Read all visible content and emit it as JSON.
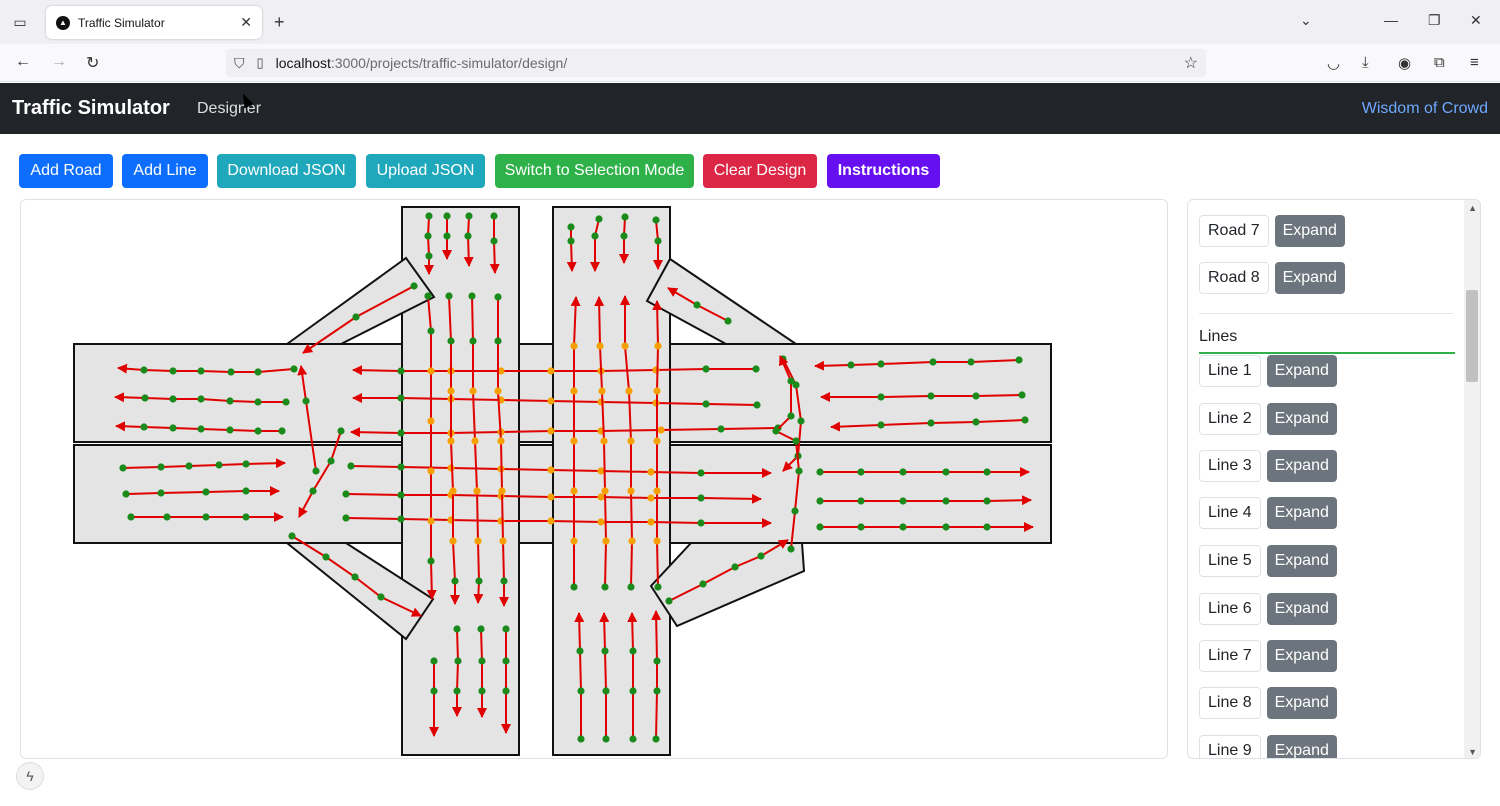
{
  "browser": {
    "tab_title": "Traffic Simulator",
    "url_host": "localhost",
    "url_path": ":3000/projects/traffic-simulator/design/",
    "icons": [
      "tab-list-icon",
      "close-tab-icon",
      "new-tab-icon",
      "minimize-icon",
      "maximize-icon",
      "close-window-icon",
      "back-icon",
      "forward-icon",
      "reload-icon",
      "shield-icon",
      "page-icon",
      "bookmark-star-icon",
      "pocket-icon",
      "download-icon",
      "account-icon",
      "extensions-icon",
      "menu-icon"
    ]
  },
  "header": {
    "brand": "Traffic Simulator",
    "nav_designer": "Designer",
    "nav_right": "Wisdom of Crowd"
  },
  "toolbar": {
    "add_road": "Add Road",
    "add_line": "Add Line",
    "download_json": "Download JSON",
    "upload_json": "Upload JSON",
    "switch_mode": "Switch to Selection Mode",
    "clear_design": "Clear Design",
    "instructions": "Instructions"
  },
  "colors": {
    "road_fill": "#e4e4e4",
    "road_stroke": "#111111",
    "line_color": "#e00000",
    "point_color": "#1a8a1a",
    "intersection_point": "#f5a000"
  },
  "side_panel": {
    "roads": [
      {
        "label": "Road 7",
        "action": "Expand"
      },
      {
        "label": "Road 8",
        "action": "Expand"
      }
    ],
    "lines_title": "Lines",
    "lines": [
      {
        "label": "Line 1",
        "action": "Expand"
      },
      {
        "label": "Line 2",
        "action": "Expand"
      },
      {
        "label": "Line 3",
        "action": "Expand"
      },
      {
        "label": "Line 4",
        "action": "Expand"
      },
      {
        "label": "Line 5",
        "action": "Expand"
      },
      {
        "label": "Line 6",
        "action": "Expand"
      },
      {
        "label": "Line 7",
        "action": "Expand"
      },
      {
        "label": "Line 8",
        "action": "Expand"
      },
      {
        "label": "Line 9",
        "action": "Expand"
      }
    ]
  }
}
